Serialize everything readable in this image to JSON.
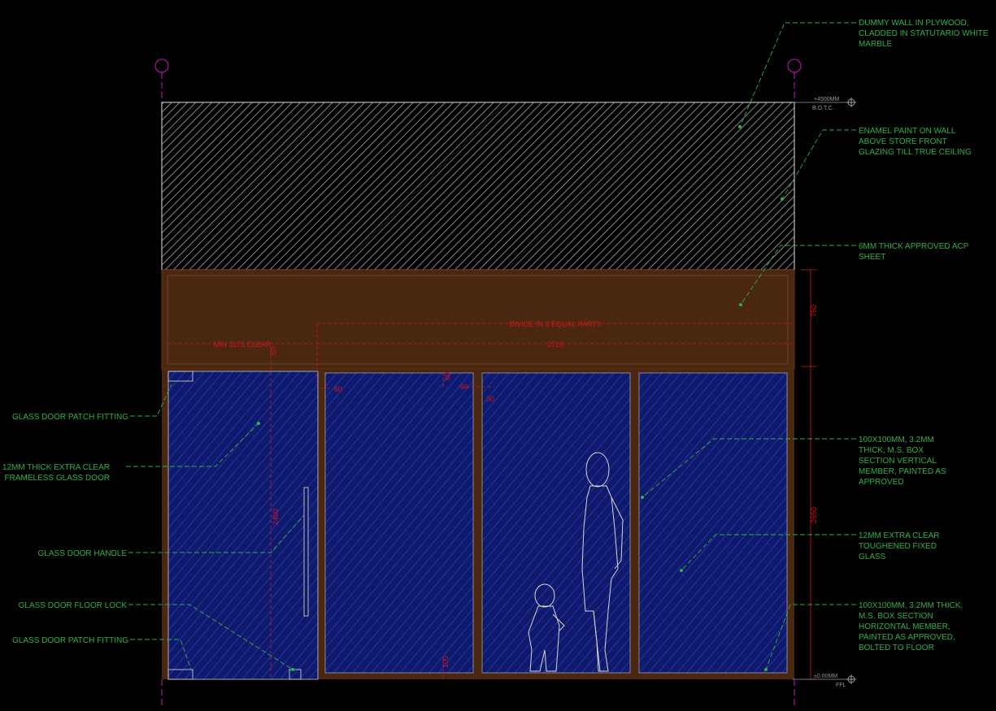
{
  "colors": {
    "background": "#000000",
    "annotation": "#2fb04a",
    "dimension": "#d0181e",
    "grid_axis": "#c21bbf",
    "wood": "#4a2710",
    "glass_hatch": "#2a3cd0",
    "marble_hatch": "#a8a8a8",
    "figure_outline": "#d6d6d6"
  },
  "levels": {
    "top_value": "+4500MM",
    "top_label": "B.O.T.C.",
    "bottom_value": "±0.00MM",
    "bottom_label": "FFL"
  },
  "dimensions": {
    "divide_equal": "DIVIDE IN 3 EQUAL PARTS",
    "min_clear": "MIN 1175 CLEAR",
    "span": "2716",
    "offset_a": "60",
    "offset_b": "60",
    "offset_c": "30",
    "offset_d": "30",
    "offset_e": "50",
    "bottom": "100",
    "fascia_height": "750",
    "glazing_height": "2650",
    "door_height": "2400"
  },
  "annotations": {
    "right": [
      "DUMMY WALL IN PLYWOOD,\nCLADDED IN STATUTARIO WHITE\nMARBLE",
      "ENAMEL PAINT ON WALL\nABOVE STORE FRONT\nGLAZING TILL TRUE CEILING",
      "6MM THICK APPROVED ACP\nSHEET",
      "100X100MM, 3.2MM\nTHICK, M.S. BOX\nSECTION VERTICAL\nMEMBER, PAINTED AS\nAPPROVED",
      "12MM EXTRA CLEAR\nTOUGHENED FIXED\nGLASS",
      "100X100MM, 3.2MM THICK,\nM.S. BOX SECTION\nHORIZONTAL MEMBER,\nPAINTED AS APPROVED,\nBOLTED TO FLOOR"
    ],
    "left": [
      "GLASS DOOR PATCH FITTING",
      "12MM THICK EXTRA CLEAR\nFRAMELESS GLASS DOOR",
      "GLASS DOOR HANDLE",
      "GLASS DOOR FLOOR LOCK",
      "GLASS DOOR PATCH FITTING"
    ]
  }
}
